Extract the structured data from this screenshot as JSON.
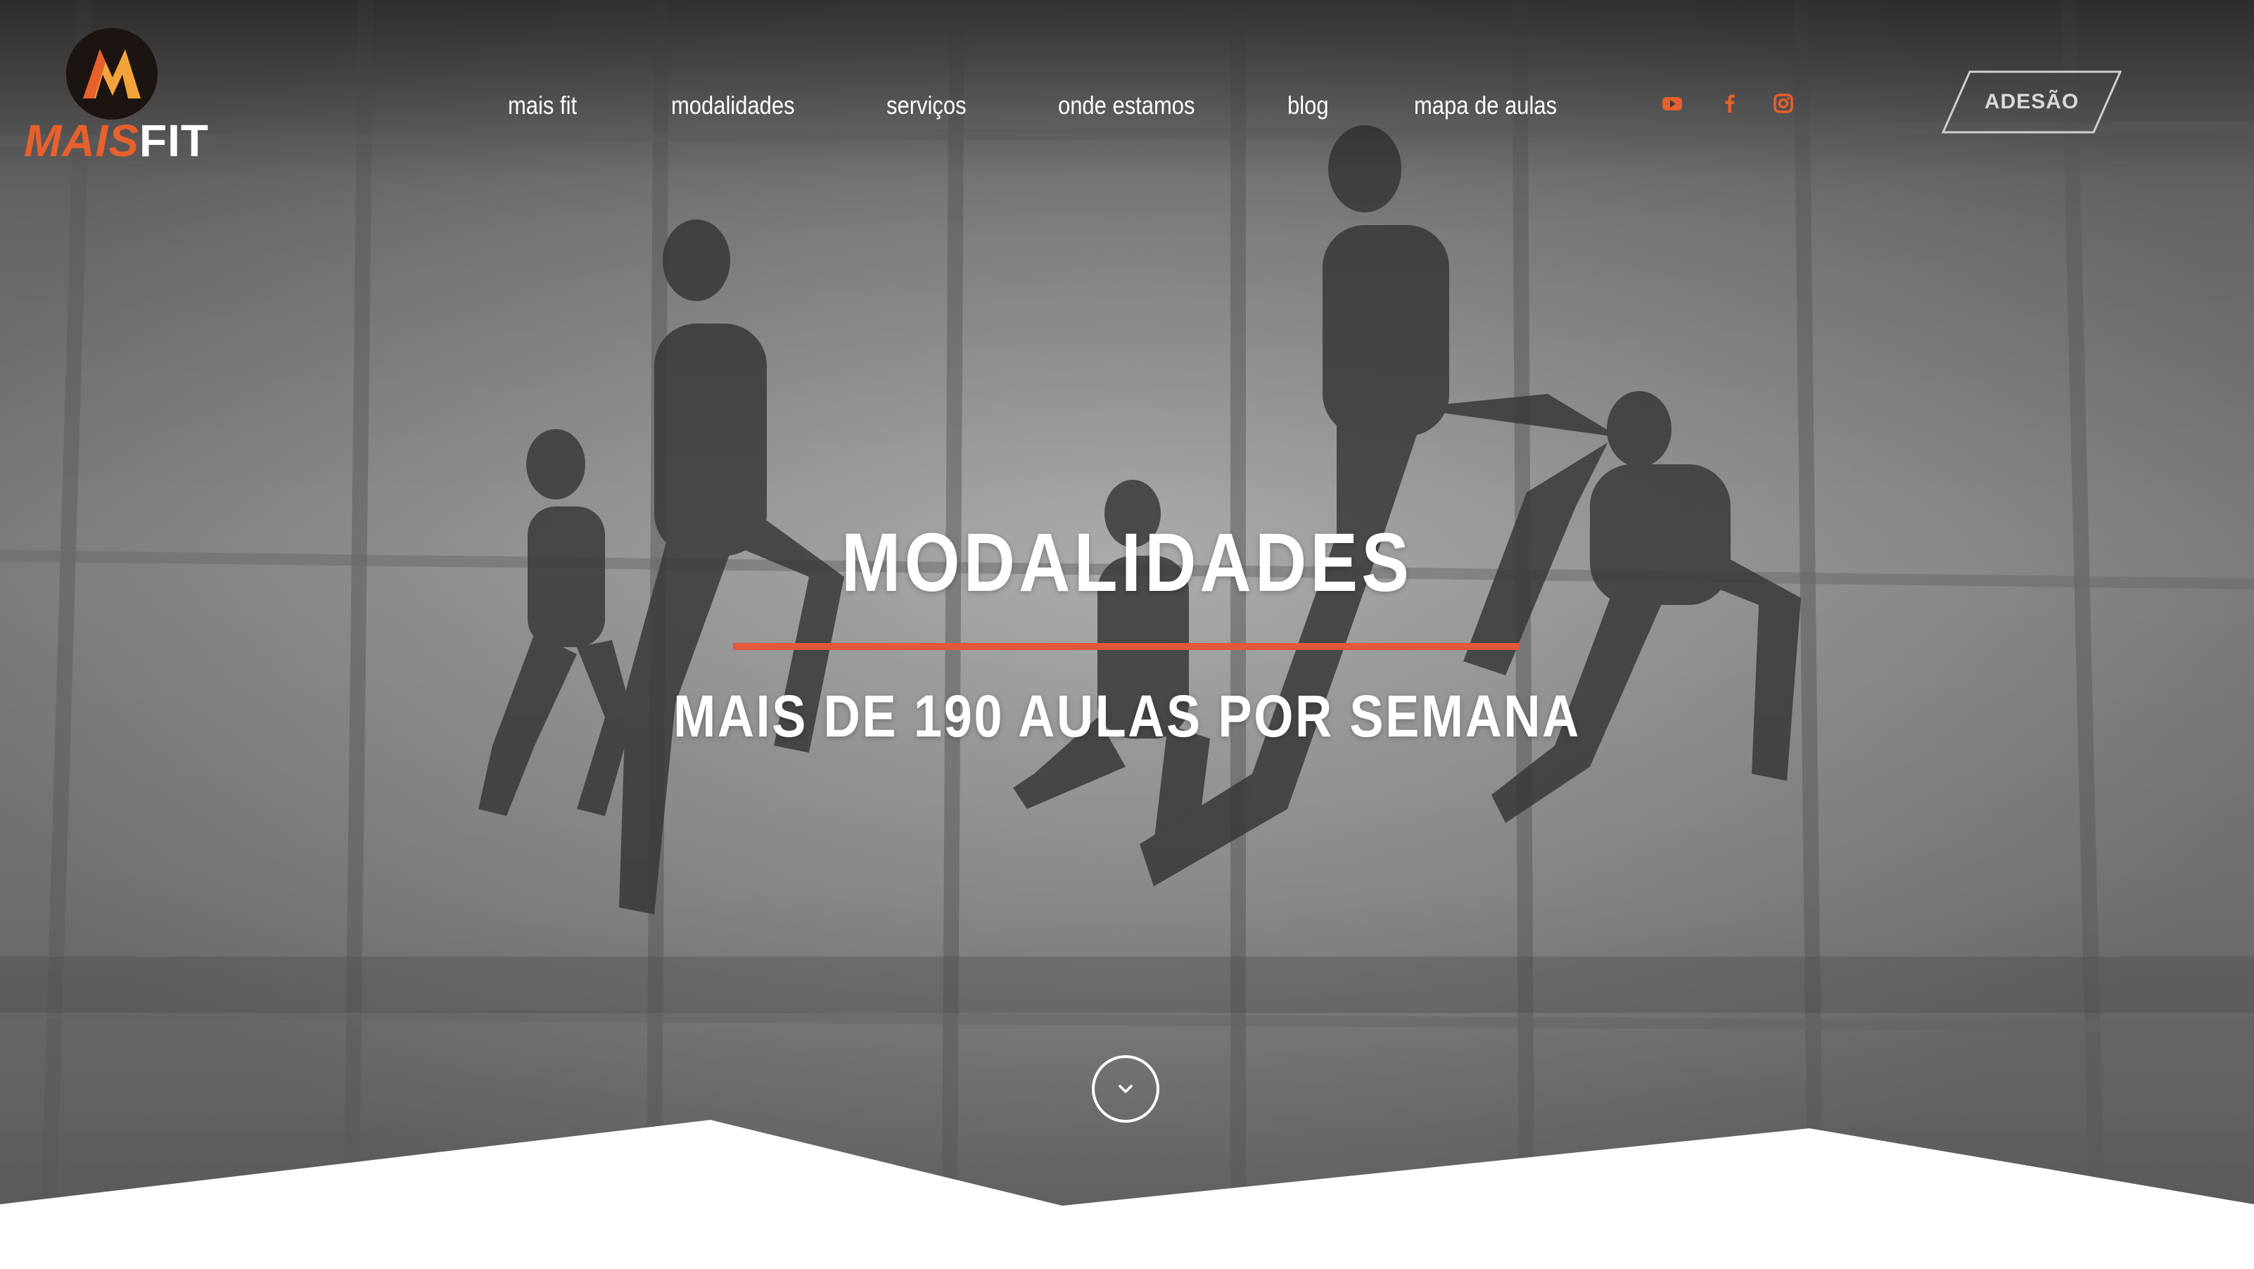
{
  "brand": {
    "logo_text_part1": "MAIS",
    "logo_text_part2": "FIT",
    "logo_letter": "M",
    "accent_color": "#e8602c"
  },
  "nav": {
    "items": [
      {
        "label": "mais fit"
      },
      {
        "label": "modalidades"
      },
      {
        "label": "serviços"
      },
      {
        "label": "onde estamos"
      },
      {
        "label": "blog"
      },
      {
        "label": "mapa de aulas"
      }
    ],
    "social": [
      {
        "icon": "youtube-icon"
      },
      {
        "icon": "facebook-icon"
      },
      {
        "icon": "instagram-icon"
      }
    ],
    "cta_label": "ADESÃO"
  },
  "hero": {
    "title": "MODALIDADES",
    "subtitle": "MAIS DE 190 AULAS POR SEMANA",
    "divider_color": "#e4573a",
    "scroll_icon": "chevron-down-icon"
  }
}
